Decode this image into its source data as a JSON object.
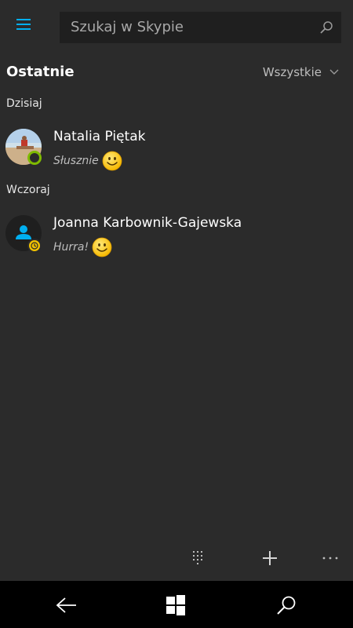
{
  "search": {
    "placeholder": "Szukaj w Skypie"
  },
  "header": {
    "title": "Ostatnie",
    "filter": "Wszystkie"
  },
  "sections": [
    {
      "label": "Dzisiaj",
      "contacts": [
        {
          "name": "Natalia Piętak",
          "message": "Słusznie",
          "status": "online",
          "avatar": "photo"
        }
      ]
    },
    {
      "label": "Wczoraj",
      "contacts": [
        {
          "name": "Joanna Karbownik-Gajewska",
          "message": "Hurra!",
          "status": "away",
          "avatar": "default"
        }
      ]
    }
  ],
  "icons": {
    "menu": "hamburger-icon",
    "search": "search-icon",
    "dialpad": "dialpad-icon",
    "add": "plus-icon",
    "more": "more-icon",
    "back": "back-arrow-icon",
    "windows": "windows-logo-icon",
    "nav_search": "search-icon"
  },
  "colors": {
    "background": "#2b2b2b",
    "accent": "#00aff0",
    "online": "#7fba00",
    "away": "#f2c200",
    "nav_bar": "#000000"
  }
}
